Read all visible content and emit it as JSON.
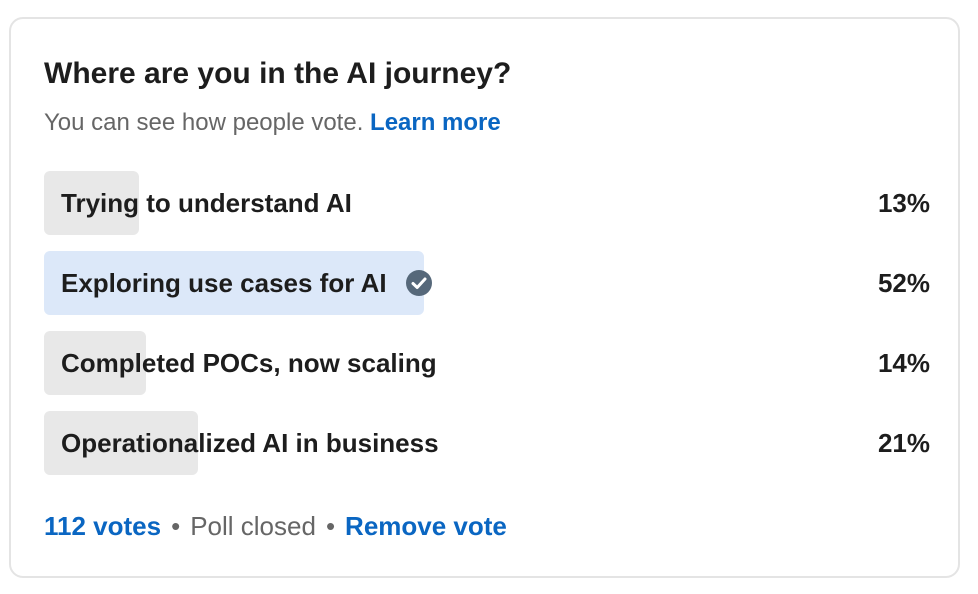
{
  "poll": {
    "question": "Where are you in the AI journey?",
    "subtitle": "You can see how people vote.",
    "learn_more": "Learn more",
    "options": [
      {
        "label": "Trying to understand AI",
        "percent": "13%",
        "fraction": 0.13,
        "selected": false
      },
      {
        "label": "Exploring use cases for AI",
        "percent": "52%",
        "fraction": 0.52,
        "selected": true
      },
      {
        "label": "Completed POCs, now scaling",
        "percent": "14%",
        "fraction": 0.14,
        "selected": false
      },
      {
        "label": "Operationalized AI in business",
        "percent": "21%",
        "fraction": 0.21,
        "selected": false
      }
    ],
    "selected_icon": "check-circle-icon",
    "votes": "112 votes",
    "separator": "•",
    "status": "Poll closed",
    "remove_vote": "Remove vote"
  },
  "colors": {
    "accent": "#0a66c2",
    "bar": "#e8e8e8",
    "bar_selected": "#dce8f9",
    "check": "#56687a"
  }
}
